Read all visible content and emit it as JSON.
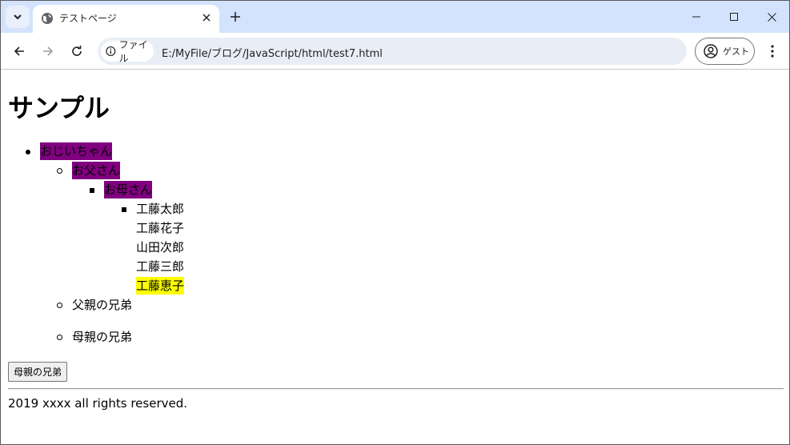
{
  "browser": {
    "tab_title": "テストページ",
    "omnibox_chip": "ファイル",
    "url": "E:/MyFile/ブログ/JavaScript/html/test7.html",
    "profile_label": "ゲスト",
    "icons": [
      "tab-search-icon",
      "globe-icon",
      "close-icon",
      "plus-icon",
      "minimize-icon",
      "maximize-icon",
      "close-icon",
      "back-arrow-icon",
      "forward-arrow-icon",
      "reload-icon",
      "info-icon",
      "user-circle-icon",
      "kebab-menu-icon"
    ]
  },
  "page": {
    "heading": "サンプル",
    "tree": {
      "grandpa": "おじいちゃん",
      "father": "お父さん",
      "mother": "お母さん",
      "children": [
        "工藤太郎",
        "工藤花子",
        "山田次郎",
        "工藤三郎",
        "工藤恵子"
      ],
      "father_siblings": "父親の兄弟",
      "mother_siblings": "母親の兄弟"
    },
    "button_label": "母親の兄弟",
    "footer": "2019 xxxx all rights reserved."
  },
  "colors": {
    "highlight_purple": "#800080",
    "highlight_yellow": "#ffff00",
    "tabstrip": "#d3e3fd"
  }
}
